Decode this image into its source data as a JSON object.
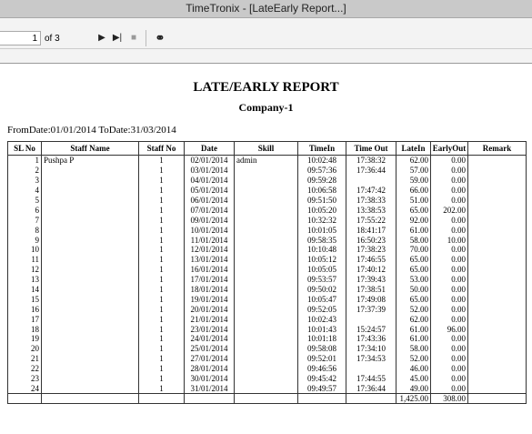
{
  "window": {
    "title": "TimeTronix - [LateEarly Report...]"
  },
  "toolbar": {
    "page_current": "1",
    "page_of": "of 3",
    "next_glyph": "▶",
    "last_glyph": "▶|",
    "stop_glyph": "■",
    "find_glyph": "⚭"
  },
  "report": {
    "title": "LATE/EARLY REPORT",
    "company": "Company-1",
    "date_range": "FromDate:01/01/2014  ToDate:31/03/2014",
    "columns": [
      "SL No",
      "Staff Name",
      "Staff No",
      "Date",
      "Skill",
      "TimeIn",
      "Time Out",
      "LateIn",
      "EarlyOut",
      "Remark"
    ],
    "rows": [
      [
        "1",
        "Pushpa P",
        "1",
        "02/01/2014",
        "admin",
        "10:02:48",
        "17:38:32",
        "62.00",
        "0.00",
        ""
      ],
      [
        "2",
        "",
        "1",
        "03/01/2014",
        "",
        "09:57:36",
        "17:36:44",
        "57.00",
        "0.00",
        ""
      ],
      [
        "3",
        "",
        "1",
        "04/01/2014",
        "",
        "09:59:28",
        "",
        "59.00",
        "0.00",
        ""
      ],
      [
        "4",
        "",
        "1",
        "05/01/2014",
        "",
        "10:06:58",
        "17:47:42",
        "66.00",
        "0.00",
        ""
      ],
      [
        "5",
        "",
        "1",
        "06/01/2014",
        "",
        "09:51:50",
        "17:38:33",
        "51.00",
        "0.00",
        ""
      ],
      [
        "6",
        "",
        "1",
        "07/01/2014",
        "",
        "10:05:20",
        "13:38:53",
        "65.00",
        "202.00",
        ""
      ],
      [
        "7",
        "",
        "1",
        "09/01/2014",
        "",
        "10:32:32",
        "17:55:22",
        "92.00",
        "0.00",
        ""
      ],
      [
        "8",
        "",
        "1",
        "10/01/2014",
        "",
        "10:01:05",
        "18:41:17",
        "61.00",
        "0.00",
        ""
      ],
      [
        "9",
        "",
        "1",
        "11/01/2014",
        "",
        "09:58:35",
        "16:50:23",
        "58.00",
        "10.00",
        ""
      ],
      [
        "10",
        "",
        "1",
        "12/01/2014",
        "",
        "10:10:48",
        "17:38:23",
        "70.00",
        "0.00",
        ""
      ],
      [
        "11",
        "",
        "1",
        "13/01/2014",
        "",
        "10:05:12",
        "17:46:55",
        "65.00",
        "0.00",
        ""
      ],
      [
        "12",
        "",
        "1",
        "16/01/2014",
        "",
        "10:05:05",
        "17:40:12",
        "65.00",
        "0.00",
        ""
      ],
      [
        "13",
        "",
        "1",
        "17/01/2014",
        "",
        "09:53:57",
        "17:39:43",
        "53.00",
        "0.00",
        ""
      ],
      [
        "14",
        "",
        "1",
        "18/01/2014",
        "",
        "09:50:02",
        "17:38:51",
        "50.00",
        "0.00",
        ""
      ],
      [
        "15",
        "",
        "1",
        "19/01/2014",
        "",
        "10:05:47",
        "17:49:08",
        "65.00",
        "0.00",
        ""
      ],
      [
        "16",
        "",
        "1",
        "20/01/2014",
        "",
        "09:52:05",
        "17:37:39",
        "52.00",
        "0.00",
        ""
      ],
      [
        "17",
        "",
        "1",
        "21/01/2014",
        "",
        "10:02:43",
        "",
        "62.00",
        "0.00",
        ""
      ],
      [
        "18",
        "",
        "1",
        "23/01/2014",
        "",
        "10:01:43",
        "15:24:57",
        "61.00",
        "96.00",
        ""
      ],
      [
        "19",
        "",
        "1",
        "24/01/2014",
        "",
        "10:01:18",
        "17:43:36",
        "61.00",
        "0.00",
        ""
      ],
      [
        "20",
        "",
        "1",
        "25/01/2014",
        "",
        "09:58:08",
        "17:34:10",
        "58.00",
        "0.00",
        ""
      ],
      [
        "21",
        "",
        "1",
        "27/01/2014",
        "",
        "09:52:01",
        "17:34:53",
        "52.00",
        "0.00",
        ""
      ],
      [
        "22",
        "",
        "1",
        "28/01/2014",
        "",
        "09:46:56",
        "",
        "46.00",
        "0.00",
        ""
      ],
      [
        "23",
        "",
        "1",
        "30/01/2014",
        "",
        "09:45:42",
        "17:44:55",
        "45.00",
        "0.00",
        ""
      ],
      [
        "24",
        "",
        "1",
        "31/01/2014",
        "",
        "09:49:57",
        "17:36:44",
        "49.00",
        "0.00",
        ""
      ]
    ],
    "totals": {
      "latein": "1,425.00",
      "earlyout": "308.00"
    }
  }
}
